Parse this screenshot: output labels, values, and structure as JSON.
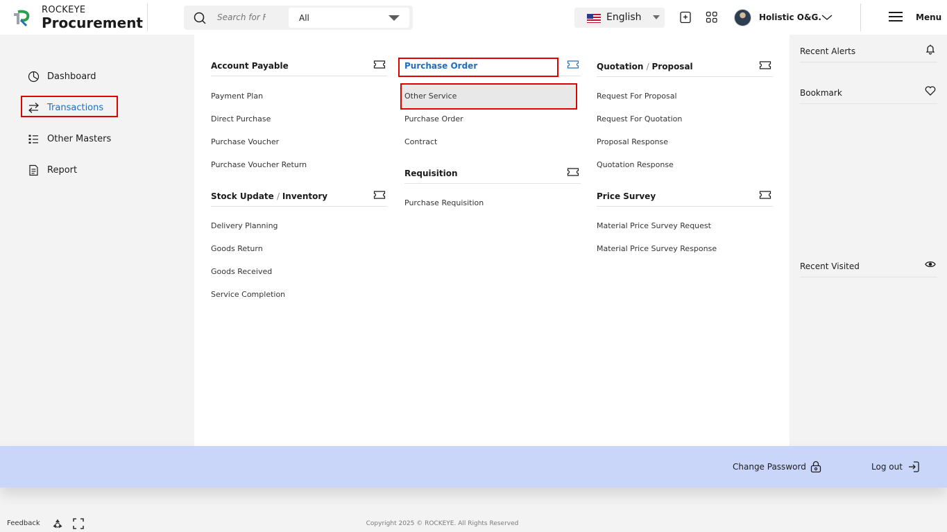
{
  "brand": {
    "company": "ROCKEYE",
    "product": "Procurement"
  },
  "search": {
    "placeholder": "Search for F",
    "scope": "All"
  },
  "language": {
    "label": "English"
  },
  "user": {
    "name": "Holistic O&G."
  },
  "menu": {
    "label": "Menu"
  },
  "nav": {
    "items": [
      {
        "label": "Dashboard",
        "icon": "dashboard-icon"
      },
      {
        "label": "Transactions",
        "icon": "transactions-icon",
        "active": true
      },
      {
        "label": "Other Masters",
        "icon": "list-icon"
      },
      {
        "label": "Report",
        "icon": "report-icon"
      }
    ]
  },
  "sections": {
    "account_payable": {
      "title": "Account Payable",
      "links": [
        "Payment Plan",
        "Direct Purchase",
        "Purchase Voucher",
        "Purchase Voucher Return"
      ]
    },
    "stock_update": {
      "title_a": "Stock Update",
      "title_b": "Inventory",
      "links": [
        "Delivery Planning",
        "Goods Return",
        "Goods Received",
        "Service Completion"
      ]
    },
    "purchase_order": {
      "title": "Purchase Order",
      "links": [
        "Other Service",
        "Purchase Order",
        "Contract"
      ]
    },
    "requisition": {
      "title": "Requisition",
      "links": [
        "Purchase Requisition"
      ]
    },
    "quotation": {
      "title_a": "Quotation",
      "title_b": "Proposal",
      "links": [
        "Request For Proposal",
        "Request For Quotation",
        "Proposal Response",
        "Quotation Response"
      ]
    },
    "price_survey": {
      "title": "Price Survey",
      "links": [
        "Material Price Survey Request",
        "Material Price Survey Response"
      ]
    }
  },
  "right_sidebar": {
    "recent_alerts": "Recent Alerts",
    "bookmark": "Bookmark",
    "recent_visited": "Recent Visited"
  },
  "bottom_bar": {
    "change_password": "Change Password",
    "logout": "Log out"
  },
  "footer": {
    "feedback": "Feedback",
    "copyright": "Copyright 2025 © ROCKEYE. All Rights Reserved"
  },
  "colors": {
    "accent": "#1f6fbf",
    "highlight_border": "#e00000",
    "bottom_bar": "#c9d6fa"
  }
}
